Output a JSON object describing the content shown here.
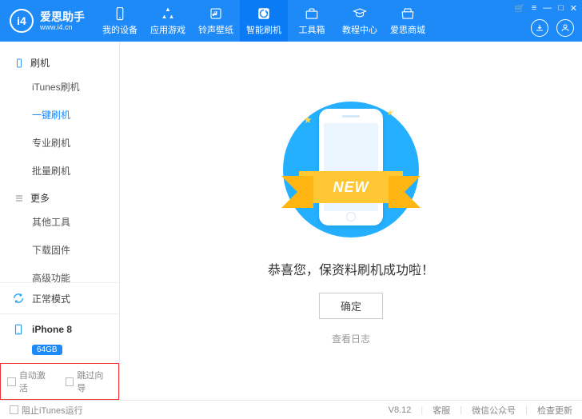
{
  "app": {
    "name": "爱思助手",
    "url": "www.i4.cn",
    "logo_text": "i4"
  },
  "titlebar": {
    "cart": "🛒",
    "menu": "≡",
    "min": "—",
    "max": "□",
    "close": "✕"
  },
  "nav": [
    {
      "icon": "device",
      "label": "我的设备"
    },
    {
      "icon": "apps",
      "label": "应用游戏"
    },
    {
      "icon": "ringtone",
      "label": "铃声壁纸"
    },
    {
      "icon": "flash",
      "label": "智能刷机",
      "active": true
    },
    {
      "icon": "toolbox",
      "label": "工具箱"
    },
    {
      "icon": "tutorial",
      "label": "教程中心"
    },
    {
      "icon": "store",
      "label": "爱思商城"
    }
  ],
  "sidebar": {
    "group1": {
      "title": "刷机",
      "items": [
        "iTunes刷机",
        "一键刷机",
        "专业刷机",
        "批量刷机"
      ],
      "active_index": 1
    },
    "group2": {
      "title": "更多",
      "items": [
        "其他工具",
        "下载固件",
        "高级功能"
      ]
    },
    "mode": "正常模式",
    "device": {
      "name": "iPhone 8",
      "storage": "64GB"
    },
    "auto_activate": "自动激活",
    "skip_guide": "跳过向导"
  },
  "main": {
    "ribbon": "NEW",
    "message": "恭喜您，保资料刷机成功啦！",
    "ok": "确定",
    "view_log": "查看日志"
  },
  "footer": {
    "block_itunes": "阻止iTunes运行",
    "version": "V8.12",
    "support": "客服",
    "wechat": "微信公众号",
    "check_update": "检查更新"
  }
}
